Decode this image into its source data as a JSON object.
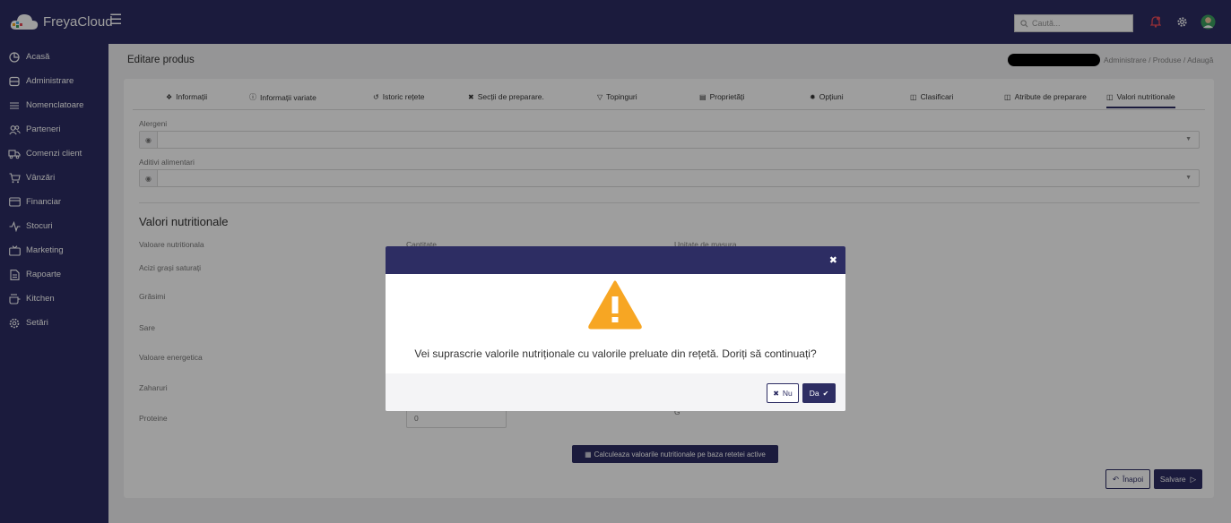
{
  "app": {
    "brand": "FreyaCloud",
    "search_placeholder": "Caută..."
  },
  "sidebar": {
    "items": [
      {
        "label": "Acasă",
        "icon": "pie-chart-icon"
      },
      {
        "label": "Administrare",
        "icon": "database-icon"
      },
      {
        "label": "Nomenclatoare",
        "icon": "list-icon"
      },
      {
        "label": "Parteneri",
        "icon": "users-icon"
      },
      {
        "label": "Comenzi client",
        "icon": "truck-icon"
      },
      {
        "label": "Vânzări",
        "icon": "cart-icon"
      },
      {
        "label": "Financiar",
        "icon": "card-icon"
      },
      {
        "label": "Stocuri",
        "icon": "activity-icon"
      },
      {
        "label": "Marketing",
        "icon": "tv-icon"
      },
      {
        "label": "Rapoarte",
        "icon": "file-icon"
      },
      {
        "label": "Kitchen",
        "icon": "pot-icon"
      },
      {
        "label": "Setări",
        "icon": "gear-icon"
      }
    ]
  },
  "header": {
    "title": "Editare produs",
    "breadcrumb": "Administrare / Produse / Adaugă"
  },
  "tabs": [
    {
      "label": "Informații",
      "icon": "info-icon"
    },
    {
      "label": "Informații variate",
      "icon": "info-circle-icon"
    },
    {
      "label": "Istoric rețete",
      "icon": "history-icon"
    },
    {
      "label": "Secții de preparare.",
      "icon": "utensils-icon"
    },
    {
      "label": "Topinguri",
      "icon": "filter-icon"
    },
    {
      "label": "Proprietăți",
      "icon": "properties-icon"
    },
    {
      "label": "Opțiuni",
      "icon": "options-icon"
    },
    {
      "label": "Clasificari",
      "icon": "book-icon"
    },
    {
      "label": "Atribute de preparare",
      "icon": "book-icon"
    },
    {
      "label": "Valori nutritionale",
      "icon": "book-icon",
      "active": true
    }
  ],
  "form": {
    "alergeni_label": "Alergeni",
    "aditivi_label": "Aditivi alimentari",
    "section_title": "Valori nutritionale",
    "columns": {
      "nutritional": "Valoare nutritionala",
      "quantity": "Cantitate",
      "unit": "Unitate de masura"
    },
    "rows": [
      {
        "label": "Acizi grași saturați"
      },
      {
        "label": "Grăsimi"
      },
      {
        "label": "Sare"
      },
      {
        "label": "Valoare energetica"
      },
      {
        "label": "Zaharuri"
      },
      {
        "label": "Proteine",
        "quantity": "0",
        "unit": "G"
      }
    ],
    "calc_button": "Calculeaza valoarile nutritionale pe baza retetei active",
    "back_button": "Înapoi",
    "save_button": "Salvare"
  },
  "modal": {
    "message": "Vei suprascrie valorile nutriționale cu valorile preluate din rețetă. Doriți să continuați?",
    "no_label": "Nu",
    "yes_label": "Da"
  },
  "colors": {
    "primary": "#2d2d63",
    "warning": "#f7a623",
    "notification": "#e94b5a"
  }
}
